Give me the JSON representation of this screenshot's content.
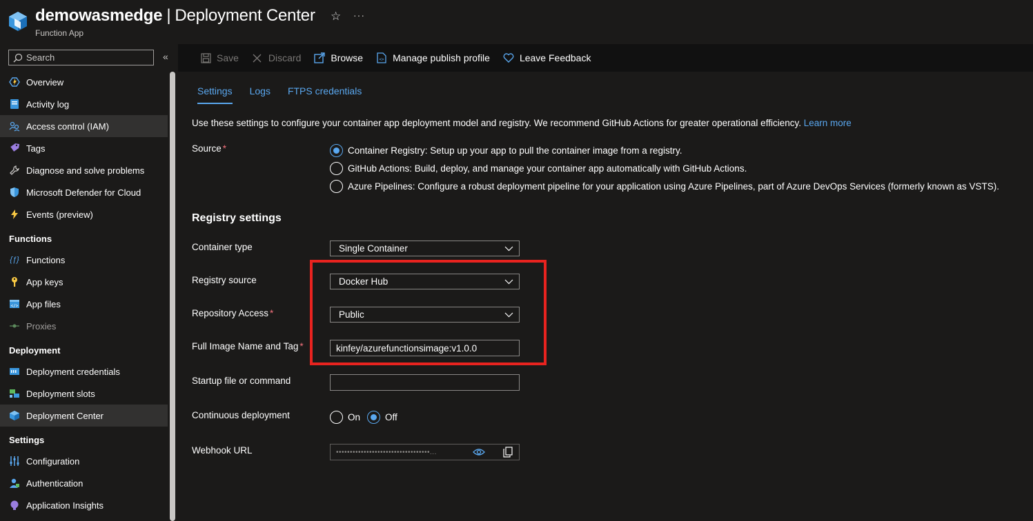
{
  "header": {
    "resource_name": "demowasmedge",
    "separator": "|",
    "page_name": "Deployment Center",
    "resource_type": "Function App"
  },
  "sidebar": {
    "search_placeholder": "Search",
    "items": [
      {
        "type": "item",
        "label": "Overview",
        "icon": "function-app-icon"
      },
      {
        "type": "item",
        "label": "Activity log",
        "icon": "activity-log-icon"
      },
      {
        "type": "item",
        "label": "Access control (IAM)",
        "icon": "people-icon",
        "active": true
      },
      {
        "type": "item",
        "label": "Tags",
        "icon": "tag-icon"
      },
      {
        "type": "item",
        "label": "Diagnose and solve problems",
        "icon": "wrench-icon"
      },
      {
        "type": "item",
        "label": "Microsoft Defender for Cloud",
        "icon": "shield-icon"
      },
      {
        "type": "item",
        "label": "Events (preview)",
        "icon": "bolt-icon"
      },
      {
        "type": "section",
        "label": "Functions"
      },
      {
        "type": "item",
        "label": "Functions",
        "icon": "function-icon"
      },
      {
        "type": "item",
        "label": "App keys",
        "icon": "key-icon"
      },
      {
        "type": "item",
        "label": "App files",
        "icon": "code-file-icon"
      },
      {
        "type": "item",
        "label": "Proxies",
        "icon": "proxy-icon",
        "disabled": true
      },
      {
        "type": "section",
        "label": "Deployment"
      },
      {
        "type": "item",
        "label": "Deployment credentials",
        "icon": "credentials-icon"
      },
      {
        "type": "item",
        "label": "Deployment slots",
        "icon": "slots-icon"
      },
      {
        "type": "item",
        "label": "Deployment Center",
        "icon": "cube-icon",
        "active": true
      },
      {
        "type": "section",
        "label": "Settings"
      },
      {
        "type": "item",
        "label": "Configuration",
        "icon": "sliders-icon"
      },
      {
        "type": "item",
        "label": "Authentication",
        "icon": "auth-user-icon"
      },
      {
        "type": "item",
        "label": "Application Insights",
        "icon": "insights-icon"
      }
    ]
  },
  "toolbar": {
    "save_label": "Save",
    "discard_label": "Discard",
    "browse_label": "Browse",
    "manage_profile_label": "Manage publish profile",
    "feedback_label": "Leave Feedback"
  },
  "tabs": [
    {
      "label": "Settings",
      "active": true
    },
    {
      "label": "Logs"
    },
    {
      "label": "FTPS credentials"
    }
  ],
  "intro": {
    "text": "Use these settings to configure your container app deployment model and registry. We recommend GitHub Actions for greater operational efficiency.",
    "link": "Learn more"
  },
  "source": {
    "label": "Source",
    "options": [
      {
        "label": "Container Registry: Setup up your app to pull the container image from a registry.",
        "selected": true
      },
      {
        "label": "GitHub Actions: Build, deploy, and manage your container app automatically with GitHub Actions.",
        "selected": false
      },
      {
        "label": "Azure Pipelines: Configure a robust deployment pipeline for your application using Azure Pipelines, part of Azure DevOps Services (formerly known as VSTS).",
        "selected": false
      }
    ]
  },
  "registry": {
    "section_title": "Registry settings",
    "container_type_label": "Container type",
    "container_type_value": "Single Container",
    "registry_source_label": "Registry source",
    "registry_source_value": "Docker Hub",
    "repository_access_label": "Repository Access",
    "repository_access_value": "Public",
    "image_label": "Full Image Name and Tag",
    "image_value": "kinfey/azurefunctionsimage:v1.0.0",
    "startup_label": "Startup file or command",
    "startup_value": "",
    "continuous_label": "Continuous deployment",
    "continuous_on": "On",
    "continuous_off": "Off",
    "webhook_label": "Webhook URL",
    "webhook_masked": "••••••••••••••••••••••••••••••••••..."
  },
  "colors": {
    "accent": "#5aa8f0",
    "highlight": "#e8231f",
    "required": "#f1707b",
    "background": "#1b1a19"
  }
}
